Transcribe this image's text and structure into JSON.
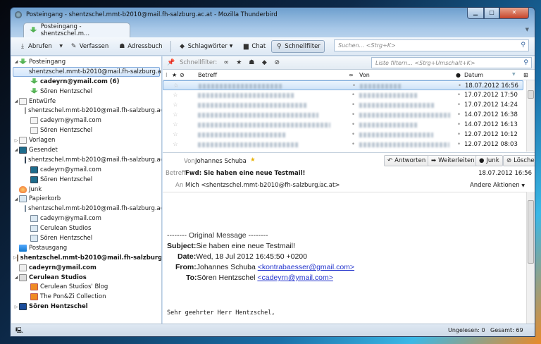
{
  "window": {
    "title": "Posteingang - shentzschel.mmt-b2010@mail.fh-salzburg.ac.at - Mozilla Thunderbird",
    "tab": "Posteingang - shentzschel.m..."
  },
  "toolbar": {
    "get": "Abrufen",
    "compose": "Verfassen",
    "addressbook": "Adressbuch",
    "tags": "Schlagwörter",
    "chat": "Chat",
    "quickfilter": "Schnellfilter",
    "search_placeholder": "Suchen... <Strg+K>"
  },
  "quickfilter": {
    "label": "Schnellfilter:",
    "placeholder": "Liste filtern... <Strg+Umschalt+K>"
  },
  "folders": [
    {
      "label": "Posteingang",
      "level": 1,
      "icon": "inbox",
      "twisty": "open"
    },
    {
      "label": "shentzschel.mmt-b2010@mail.fh-salzburg.ac.at",
      "level": 2,
      "icon": "inbox",
      "selected": true
    },
    {
      "label": "cadeyrn@ymail.com (6)",
      "level": 2,
      "icon": "inbox",
      "bold": true
    },
    {
      "label": "Sören Hentzschel",
      "level": 2,
      "icon": "inbox"
    },
    {
      "label": "Entwürfe",
      "level": 1,
      "icon": "draft",
      "twisty": "open"
    },
    {
      "label": "shentzschel.mmt-b2010@mail.fh-salzburg.ac.at",
      "level": 2,
      "icon": "draft"
    },
    {
      "label": "cadeyrn@ymail.com",
      "level": 2,
      "icon": "draft"
    },
    {
      "label": "Sören Hentzschel",
      "level": 2,
      "icon": "draft"
    },
    {
      "label": "Vorlagen",
      "level": 1,
      "icon": "draft",
      "twisty": "closed"
    },
    {
      "label": "Gesendet",
      "level": 1,
      "icon": "sent",
      "twisty": "open"
    },
    {
      "label": "shentzschel.mmt-b2010@mail.fh-salzburg.ac.at",
      "level": 2,
      "icon": "sent"
    },
    {
      "label": "cadeyrn@ymail.com",
      "level": 2,
      "icon": "sent"
    },
    {
      "label": "Sören Hentzschel",
      "level": 2,
      "icon": "sent"
    },
    {
      "label": "Junk",
      "level": 1,
      "icon": "junk"
    },
    {
      "label": "Papierkorb",
      "level": 1,
      "icon": "trash",
      "twisty": "open"
    },
    {
      "label": "shentzschel.mmt-b2010@mail.fh-salzburg.ac.at",
      "level": 2,
      "icon": "trash"
    },
    {
      "label": "cadeyrn@ymail.com",
      "level": 2,
      "icon": "trash"
    },
    {
      "label": "Cerulean Studios",
      "level": 2,
      "icon": "trash"
    },
    {
      "label": "Sören Hentzschel",
      "level": 2,
      "icon": "trash"
    },
    {
      "label": "Postausgang",
      "level": 1,
      "icon": "outbox"
    },
    {
      "label": "shentzschel.mmt-b2010@mail.fh-salzburg.ac.at",
      "level": 1,
      "icon": "acc",
      "bold": true,
      "twisty": "closed"
    },
    {
      "label": "cadeyrn@ymail.com",
      "level": 1,
      "icon": "mail",
      "bold": true
    },
    {
      "label": "Cerulean Studios",
      "level": 1,
      "icon": "news",
      "bold": true,
      "twisty": "open"
    },
    {
      "label": "Cerulean Studios' Blog",
      "level": 2,
      "icon": "rss"
    },
    {
      "label": "The Pon&Zi Collection",
      "level": 2,
      "icon": "rss"
    },
    {
      "label": "Sören Hentzschel",
      "level": 1,
      "icon": "pc",
      "bold": true,
      "twisty": "closed"
    }
  ],
  "columns": {
    "subject": "Betreff",
    "from": "Von",
    "date": "Datum"
  },
  "messages": [
    {
      "date": "18.07.2012 16:56",
      "selected": true
    },
    {
      "date": "17.07.2012 17:50"
    },
    {
      "date": "17.07.2012 14:24"
    },
    {
      "date": "14.07.2012 16:38"
    },
    {
      "date": "14.07.2012 16:13"
    },
    {
      "date": "12.07.2012 10:12"
    },
    {
      "date": "12.07.2012 08:03"
    }
  ],
  "preview": {
    "from_label": "Von",
    "from": "Johannes Schuba",
    "subject_label": "Betreff",
    "subject": "Fwd: Sie haben eine neue Testmail!",
    "date": "18.07.2012 16:56",
    "to_label": "An",
    "to": "Mich <shentzschel.mmt-b2010@fh-salzburg.ac.at>",
    "reply": "Antworten",
    "forward": "Weiterleiten",
    "junk": "Junk",
    "delete": "Löschen",
    "other": "Andere Aktionen"
  },
  "body": {
    "orig": "-------- Original Message --------",
    "subject_k": "Subject:",
    "subject_v": "Sie haben eine neue Testmail!",
    "date_k": "Date:",
    "date_v": "Wed, 18 Jul 2012 16:45:50 +0200",
    "from_k": "From:",
    "from_v": "Johannes Schuba ",
    "from_mail": "<kontrabaesser@gmail.com>",
    "to_k": "To:",
    "to_v": "Sören Hentzschel ",
    "to_mail": "<cadeyrn@ymail.com>",
    "greeting": "Sehr geehrter Herr Hentzschel,"
  },
  "status": {
    "unread": "Ungelesen: 0",
    "total": "Gesamt: 69"
  }
}
